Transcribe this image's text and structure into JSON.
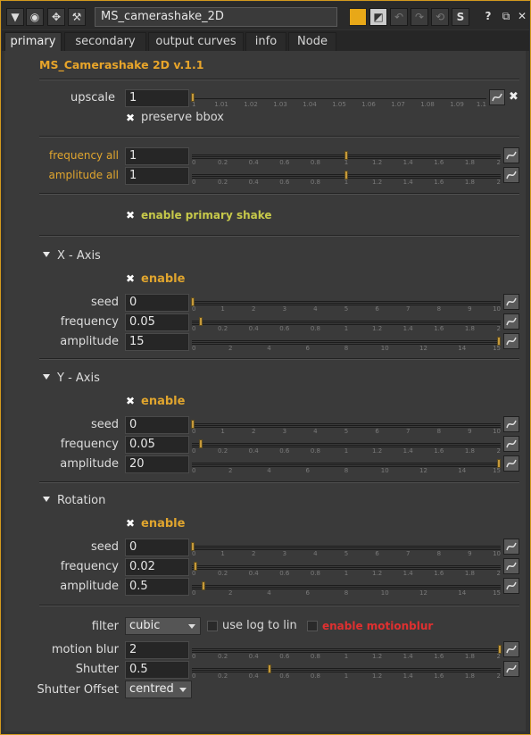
{
  "node_name": "MS_camerashake_2D",
  "tabs": [
    "primary",
    "secondary",
    "output curves",
    "info",
    "Node"
  ],
  "heading": "MS_Camerashake 2D v.1.1",
  "upscale": {
    "label": "upscale",
    "value": "1",
    "ticks": [
      "1",
      "1.01",
      "1.02",
      "1.03",
      "1.04",
      "1.05",
      "1.06",
      "1.07",
      "1.08",
      "1.09",
      "1.1"
    ]
  },
  "preserve_bbox": {
    "label": "preserve bbox",
    "checked": true
  },
  "frequency_all": {
    "label": "frequency all",
    "value": "1"
  },
  "amplitude_all": {
    "label": "amplitude all",
    "value": "1"
  },
  "ticks_0_2": [
    "0",
    "0.2",
    "0.4",
    "0.6",
    "0.8",
    "1",
    "1.2",
    "1.4",
    "1.6",
    "1.8",
    "2"
  ],
  "ticks_0_10": [
    "0",
    "1",
    "2",
    "3",
    "4",
    "5",
    "6",
    "7",
    "8",
    "9",
    "10"
  ],
  "ticks_0_15": [
    "0",
    "2",
    "4",
    "6",
    "8",
    "10",
    "12",
    "14",
    "15"
  ],
  "enable_primary": {
    "label": "enable primary shake",
    "checked": true
  },
  "x_axis": {
    "title": "X - Axis",
    "enable": "enable",
    "seed_label": "seed",
    "seed": "0",
    "frequency_label": "frequency",
    "frequency": "0.05",
    "amplitude_label": "amplitude",
    "amplitude": "15"
  },
  "y_axis": {
    "title": "Y - Axis",
    "enable": "enable",
    "seed_label": "seed",
    "seed": "0",
    "frequency_label": "frequency",
    "frequency": "0.05",
    "amplitude_label": "amplitude",
    "amplitude": "20"
  },
  "rotation": {
    "title": "Rotation",
    "enable": "enable",
    "seed_label": "seed",
    "seed": "0",
    "frequency_label": "frequency",
    "frequency": "0.02",
    "amplitude_label": "amplitude",
    "amplitude": "0.5"
  },
  "filter": {
    "label": "filter",
    "value": "cubic",
    "log_label": "use log to lin",
    "motionblur_label": "enable motionblur"
  },
  "motion_blur": {
    "label": "motion blur",
    "value": "2"
  },
  "shutter": {
    "label": "Shutter",
    "value": "0.5"
  },
  "shutter_offset": {
    "label": "Shutter Offset",
    "value": "centred"
  },
  "colors": {
    "accent": "#e0a52e",
    "warning": "#e03030",
    "primary_shake": "#c7c94a"
  }
}
